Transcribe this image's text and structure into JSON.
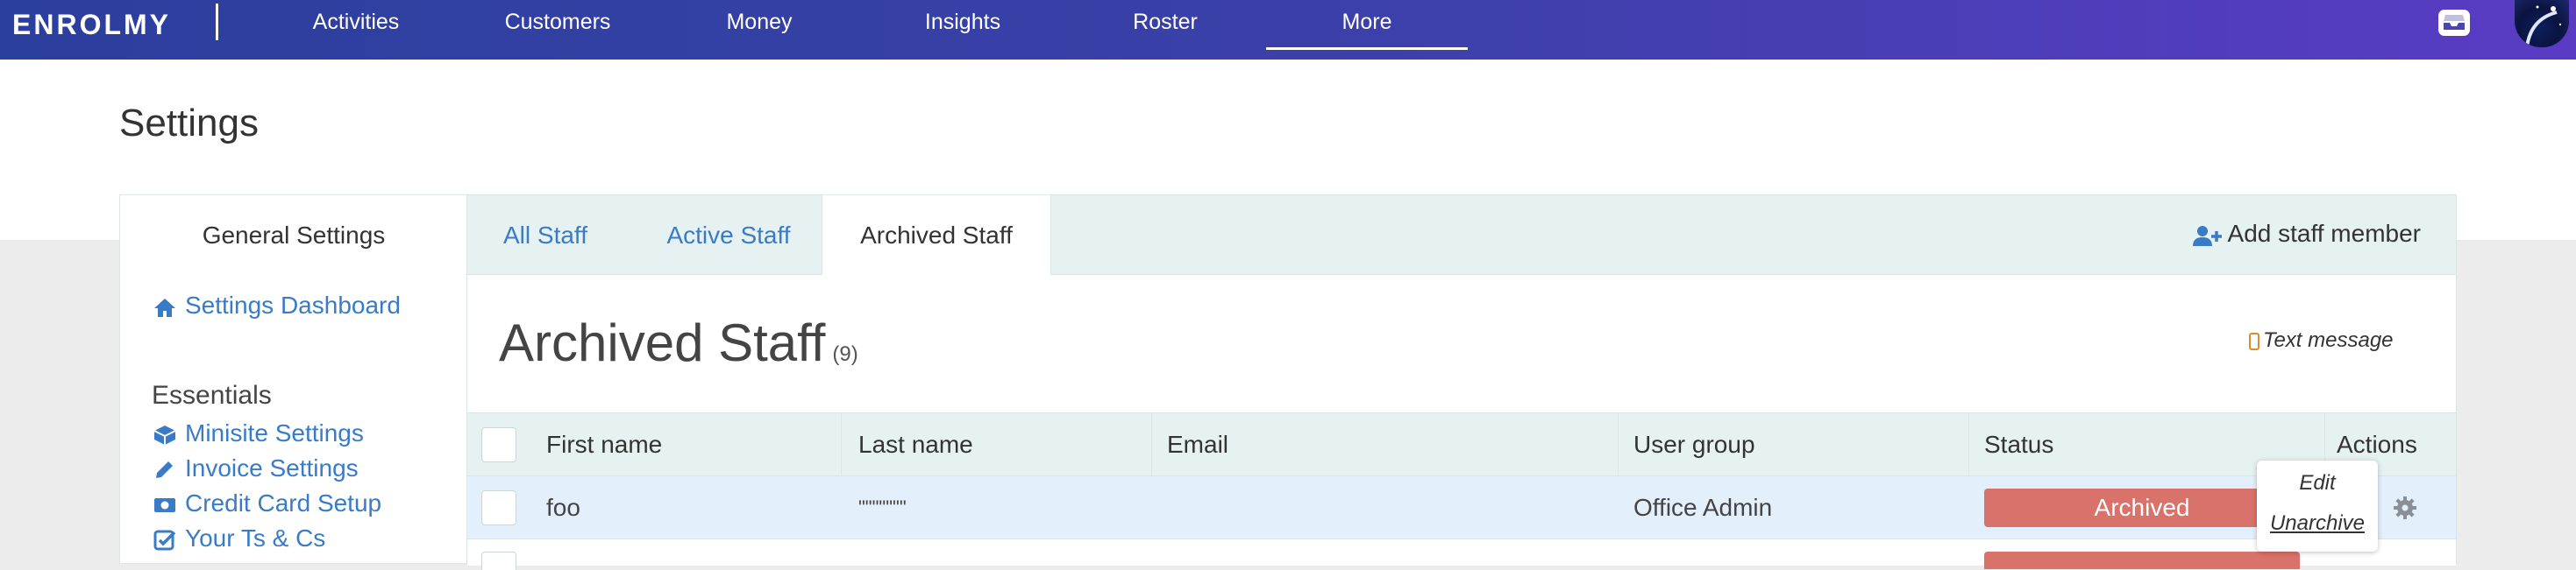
{
  "app": {
    "logo": "ENROLMY",
    "nav": [
      "Activities",
      "Customers",
      "Money",
      "Insights",
      "Roster",
      "More"
    ],
    "active_nav": "More"
  },
  "page": {
    "title": "Settings"
  },
  "sidebar": {
    "title": "General Settings",
    "dashboard_link": "Settings Dashboard",
    "section": "Essentials",
    "items": [
      {
        "label": "Minisite Settings",
        "icon": "cube-icon"
      },
      {
        "label": "Invoice Settings",
        "icon": "pencil-icon"
      },
      {
        "label": "Credit Card Setup",
        "icon": "money-icon"
      },
      {
        "label": "Your Ts & Cs",
        "icon": "check-square-icon"
      }
    ]
  },
  "tabs": [
    "All Staff",
    "Active Staff",
    "Archived Staff"
  ],
  "active_tab": "Archived Staff",
  "add_staff_label": "Add staff member",
  "section": {
    "title": "Archived Staff",
    "count": "(9)",
    "sms_label": "Text message"
  },
  "table": {
    "headers": [
      "First name",
      "Last name",
      "Email",
      "User group",
      "Status",
      "Actions"
    ],
    "rows": [
      {
        "first": "foo",
        "last": "\"\"\"\"\"\"\"",
        "email": "",
        "group": "Office Admin",
        "status": "Archived"
      }
    ]
  },
  "action_menu": {
    "edit": "Edit",
    "unarchive": "Unarchive"
  },
  "colors": {
    "accent": "#3a7bc8",
    "archived": "#d9726a",
    "nav_start": "#2b3f9e",
    "nav_end": "#5a3cc4"
  }
}
